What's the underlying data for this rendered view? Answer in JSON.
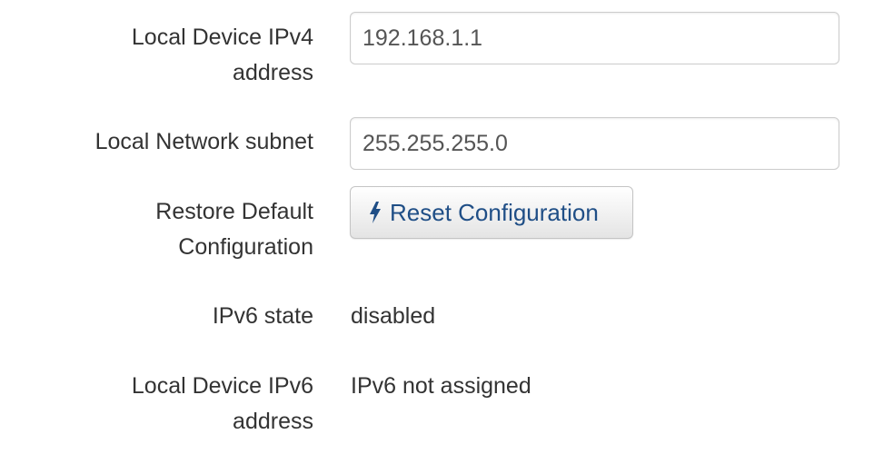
{
  "fields": {
    "ipv4": {
      "label_line1": "Local Device IPv4",
      "label_line2": "address",
      "value": "192.168.1.1"
    },
    "subnet": {
      "label": "Local Network subnet",
      "value": "255.255.255.0"
    },
    "restore": {
      "label_line1": "Restore Default",
      "label_line2": "Configuration",
      "button_label": "Reset Configuration",
      "button_icon": "bolt-icon"
    },
    "ipv6_state": {
      "label": "IPv6 state",
      "value": "disabled"
    },
    "ipv6_address": {
      "label_line1": "Local Device IPv6",
      "label_line2": "address",
      "value": "IPv6 not assigned"
    }
  },
  "colors": {
    "text": "#333333",
    "input_text": "#555555",
    "button_text": "#1f4e86",
    "border": "#cccccc"
  }
}
